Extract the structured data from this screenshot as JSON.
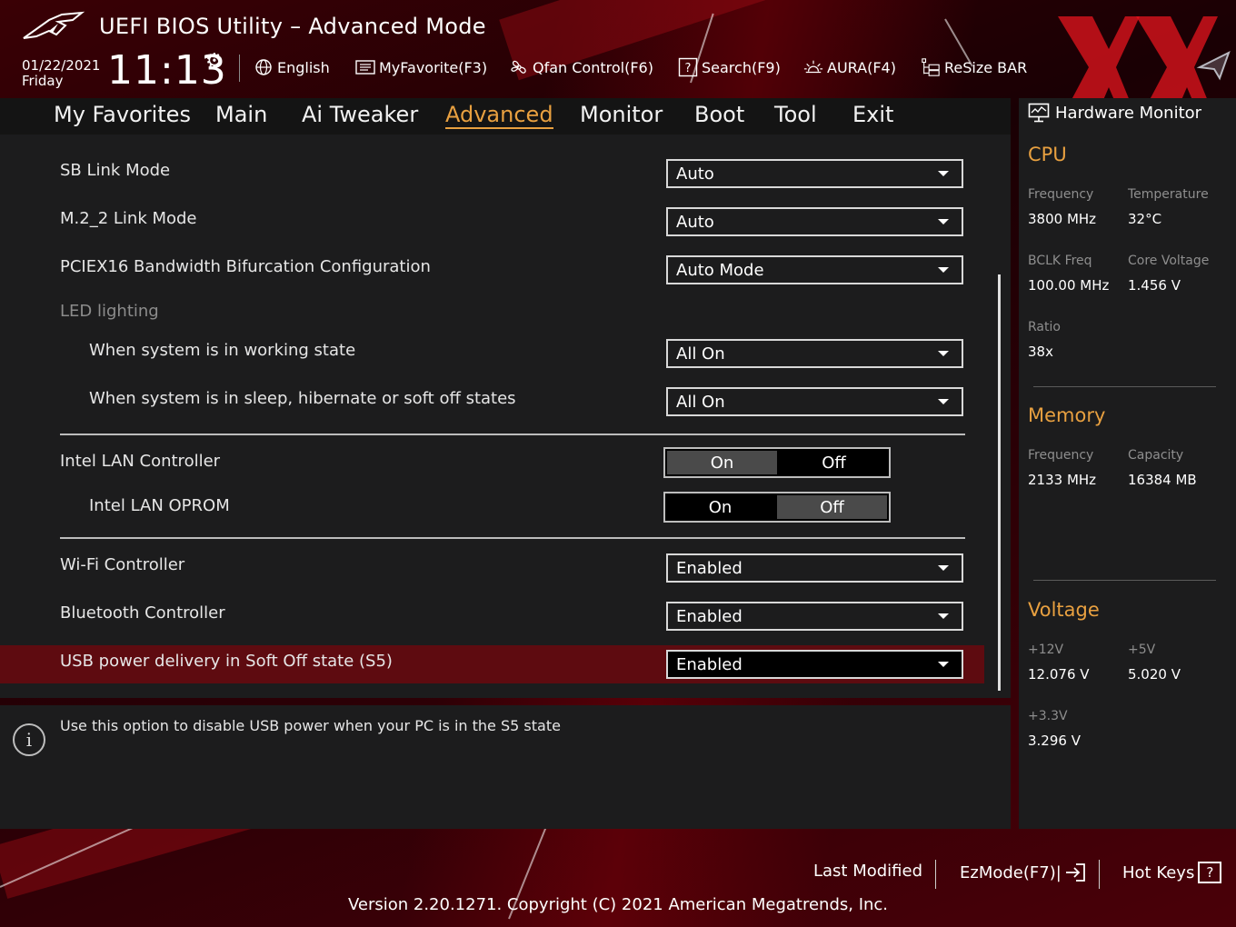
{
  "header": {
    "title": "UEFI BIOS Utility – Advanced Mode",
    "date": "01/22/2021",
    "day": "Friday",
    "time": "11:13",
    "toolbar": {
      "language": "English",
      "myfavorite": "MyFavorite(F3)",
      "qfan": "Qfan Control(F6)",
      "search": "Search(F9)",
      "aura": "AURA(F4)",
      "resizebar": "ReSize BAR"
    }
  },
  "nav": {
    "tabs": [
      "My Favorites",
      "Main",
      "Ai Tweaker",
      "Advanced",
      "Monitor",
      "Boot",
      "Tool",
      "Exit"
    ],
    "active": "Advanced"
  },
  "settings": {
    "sb_link_mode": {
      "label": "SB Link Mode",
      "value": "Auto"
    },
    "m2_2_link_mode": {
      "label": "M.2_2 Link Mode",
      "value": "Auto"
    },
    "pciex16": {
      "label": "PCIEX16 Bandwidth Bifurcation Configuration",
      "value": "Auto Mode"
    },
    "led_group": "LED lighting",
    "led_working": {
      "label": "When system is in working state",
      "value": "All On"
    },
    "led_sleep": {
      "label": "When system is in sleep, hibernate or soft off states",
      "value": "All On"
    },
    "intel_lan": {
      "label": "Intel LAN Controller",
      "on": "On",
      "off": "Off",
      "selected": "On"
    },
    "intel_lan_oprom": {
      "label": "Intel LAN OPROM",
      "on": "On",
      "off": "Off",
      "selected": "Off"
    },
    "wifi": {
      "label": "Wi-Fi Controller",
      "value": "Enabled"
    },
    "bluetooth": {
      "label": "Bluetooth Controller",
      "value": "Enabled"
    },
    "usb_power": {
      "label": "USB power delivery in Soft Off state (S5)",
      "value": "Enabled"
    }
  },
  "info": {
    "icon": "info-icon",
    "text": "Use this option to disable USB power when your PC is in the S5 state"
  },
  "hw_monitor": {
    "title": "Hardware Monitor",
    "cpu": {
      "heading": "CPU",
      "frequency_label": "Frequency",
      "frequency": "3800 MHz",
      "temperature_label": "Temperature",
      "temperature": "32°C",
      "bclk_label": "BCLK Freq",
      "bclk": "100.00 MHz",
      "core_voltage_label": "Core Voltage",
      "core_voltage": "1.456 V",
      "ratio_label": "Ratio",
      "ratio": "38x"
    },
    "memory": {
      "heading": "Memory",
      "frequency_label": "Frequency",
      "frequency": "2133 MHz",
      "capacity_label": "Capacity",
      "capacity": "16384 MB"
    },
    "voltage": {
      "heading": "Voltage",
      "v12_label": "+12V",
      "v12": "12.076 V",
      "v5_label": "+5V",
      "v5": "5.020 V",
      "v33_label": "+3.3V",
      "v33": "3.296 V"
    }
  },
  "footer": {
    "last_modified": "Last Modified",
    "ezmode": "EzMode(F7)|",
    "hotkeys": "Hot Keys",
    "hotkeys_glyph": "?",
    "version": "Version 2.20.1271. Copyright (C) 2021 American Megatrends, Inc."
  },
  "colors": {
    "accent": "#e8a040",
    "highlight_row": "#5e0b10",
    "panel": "#1c1c1d"
  }
}
